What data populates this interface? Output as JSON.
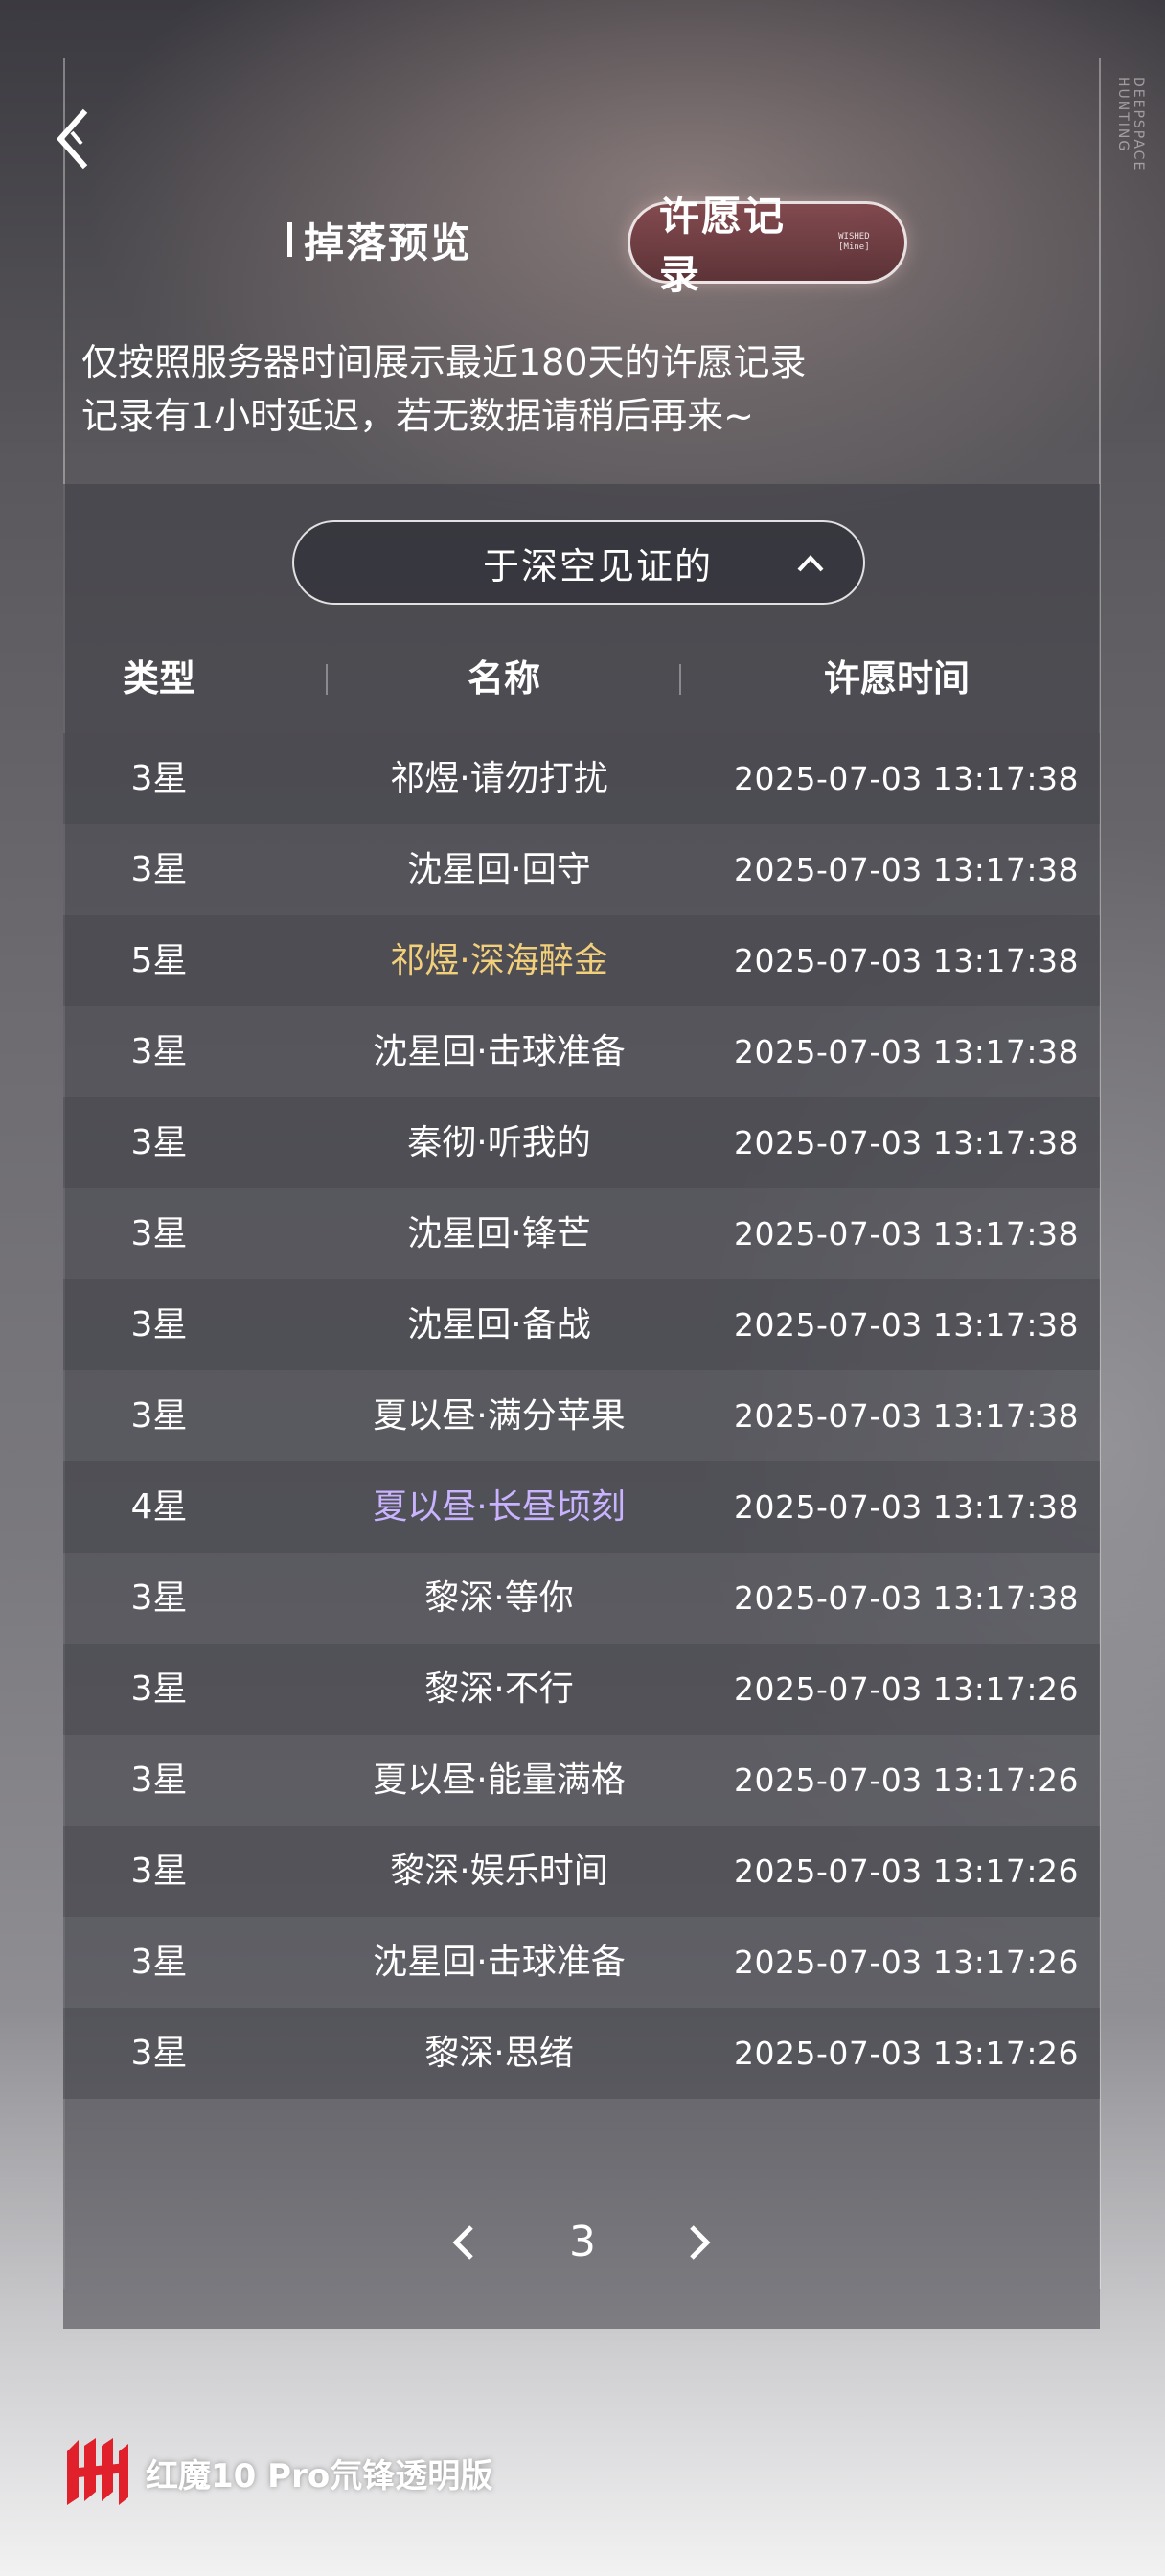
{
  "background": {
    "watermark_text": "DEEPSPACE HUNTING"
  },
  "nav": {
    "back_icon": "chevron-left-icon"
  },
  "tabs": [
    {
      "label": "掉落预览",
      "selected": false
    },
    {
      "label": "许愿记录",
      "selected": true,
      "badge": "WISHED [Mine]"
    }
  ],
  "notice": {
    "line1": "仅按照服务器时间展示最近180天的许愿记录",
    "line2": "记录有1小时延迟，若无数据请稍后再来~"
  },
  "filter": {
    "selected": "于深空见证的",
    "icon": "chevron-up-icon"
  },
  "table": {
    "headers": {
      "type": "类型",
      "name": "名称",
      "time": "许愿时间"
    },
    "rows": [
      {
        "type": "3星",
        "name": "祁煜·请勿打扰",
        "time": "2025-07-03 13:17:38",
        "rarity": "3"
      },
      {
        "type": "3星",
        "name": "沈星回·回守",
        "time": "2025-07-03 13:17:38",
        "rarity": "3"
      },
      {
        "type": "5星",
        "name": "祁煜·深海醉金",
        "time": "2025-07-03 13:17:38",
        "rarity": "5"
      },
      {
        "type": "3星",
        "name": "沈星回·击球准备",
        "time": "2025-07-03 13:17:38",
        "rarity": "3"
      },
      {
        "type": "3星",
        "name": "秦彻·听我的",
        "time": "2025-07-03 13:17:38",
        "rarity": "3"
      },
      {
        "type": "3星",
        "name": "沈星回·锋芒",
        "time": "2025-07-03 13:17:38",
        "rarity": "3"
      },
      {
        "type": "3星",
        "name": "沈星回·备战",
        "time": "2025-07-03 13:17:38",
        "rarity": "3"
      },
      {
        "type": "3星",
        "name": "夏以昼·满分苹果",
        "time": "2025-07-03 13:17:38",
        "rarity": "3"
      },
      {
        "type": "4星",
        "name": "夏以昼·长昼顷刻",
        "time": "2025-07-03 13:17:38",
        "rarity": "4"
      },
      {
        "type": "3星",
        "name": "黎深·等你",
        "time": "2025-07-03 13:17:38",
        "rarity": "3"
      },
      {
        "type": "3星",
        "name": "黎深·不行",
        "time": "2025-07-03 13:17:26",
        "rarity": "3"
      },
      {
        "type": "3星",
        "name": "夏以昼·能量满格",
        "time": "2025-07-03 13:17:26",
        "rarity": "3"
      },
      {
        "type": "3星",
        "name": "黎深·娱乐时间",
        "time": "2025-07-03 13:17:26",
        "rarity": "3"
      },
      {
        "type": "3星",
        "name": "沈星回·击球准备",
        "time": "2025-07-03 13:17:26",
        "rarity": "3"
      },
      {
        "type": "3星",
        "name": "黎深·思绪",
        "time": "2025-07-03 13:17:26",
        "rarity": "3"
      }
    ]
  },
  "pagination": {
    "current_page": "3",
    "prev_icon": "chevron-left-icon",
    "next_icon": "chevron-right-icon"
  },
  "brand": {
    "text": "红魔10 Pro氘锋透明版",
    "logo": "redmagic-logo"
  },
  "colors": {
    "rarity_5": "#f2cf7a",
    "rarity_4": "#c9b3ff",
    "rarity_3": "#ffffff",
    "wish_tab": "#82464b"
  }
}
